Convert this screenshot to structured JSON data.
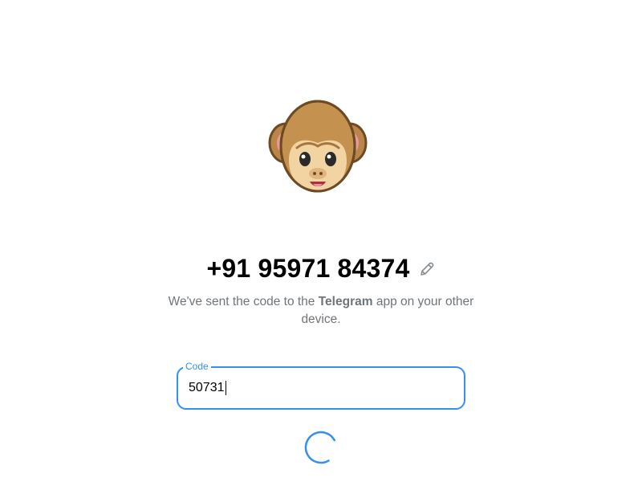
{
  "auth": {
    "phone_number": "+91 95971 84374",
    "subtitle_before": "We've sent the code to the ",
    "subtitle_app": "Telegram",
    "subtitle_after": " app on your other device.",
    "code_label": "Code",
    "code_value": "50731"
  },
  "icons": {
    "avatar": "monkey-face",
    "edit": "pencil-icon",
    "loading": "spinner-icon"
  },
  "colors": {
    "accent": "#3390ec",
    "secondary_text": "#707579",
    "primary_text": "#000000"
  }
}
